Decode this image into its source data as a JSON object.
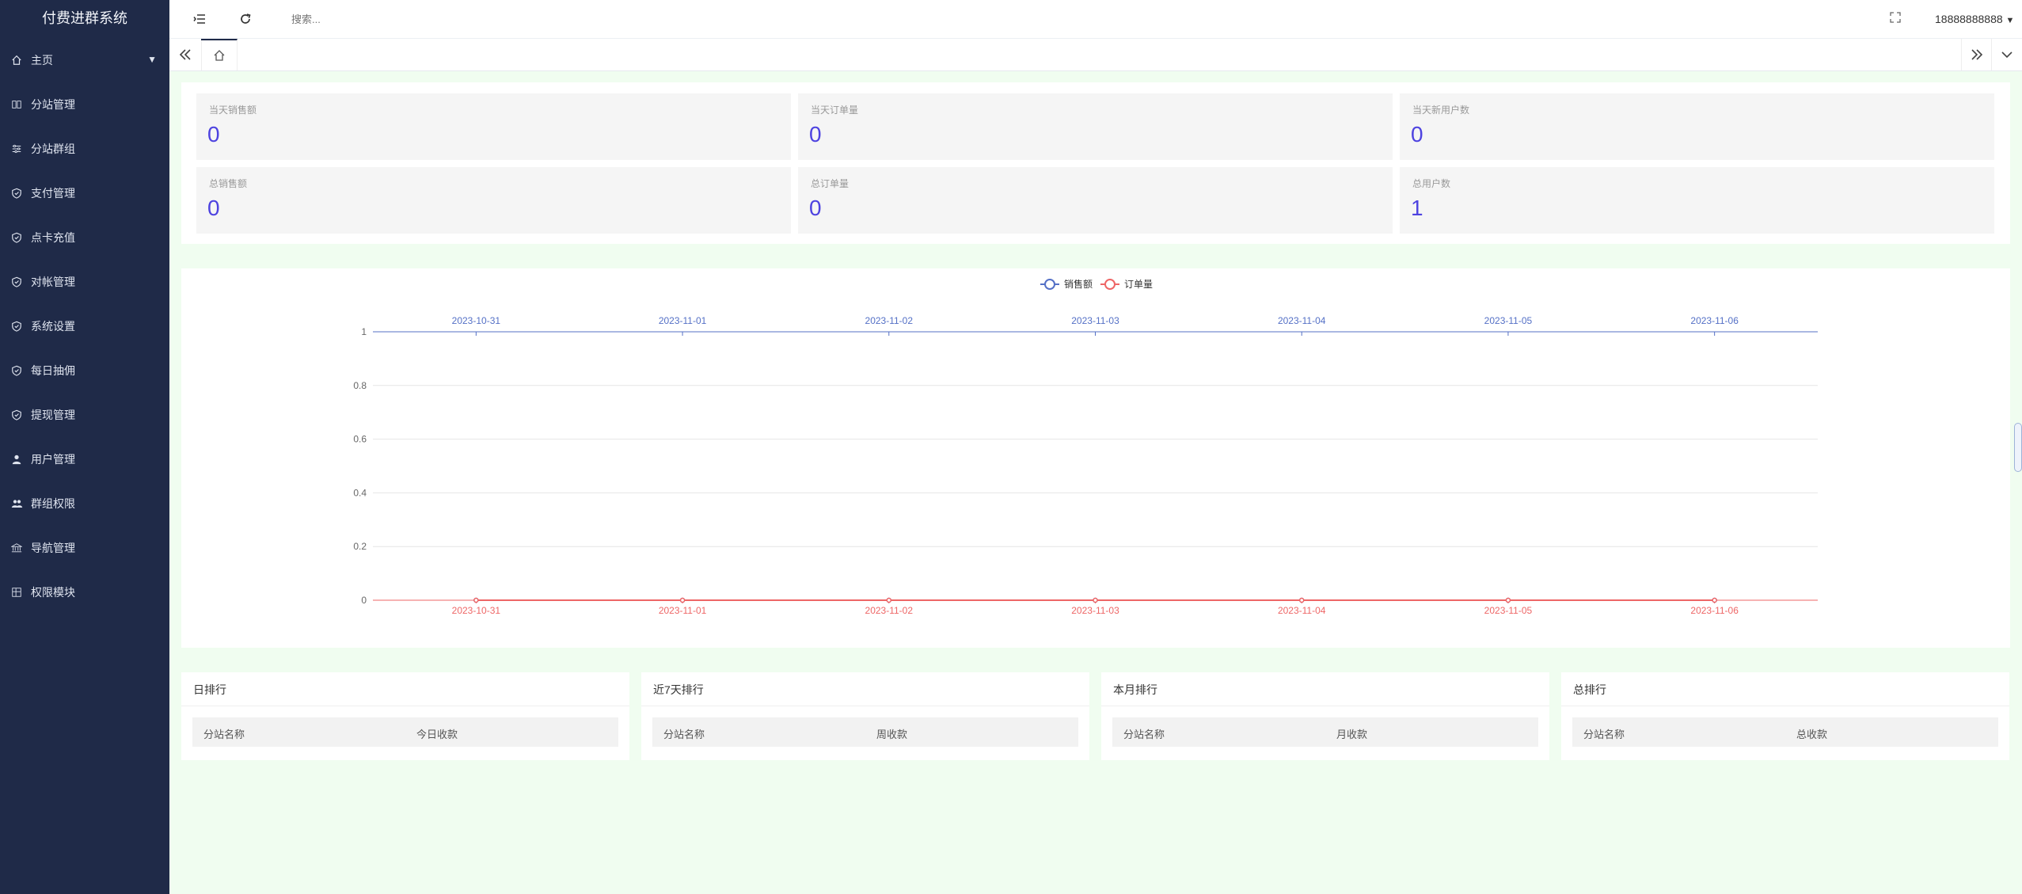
{
  "app": {
    "title": "付费进群系统"
  },
  "sidebar": {
    "items": [
      {
        "label": "主页",
        "icon": "home-icon"
      },
      {
        "label": "分站管理",
        "icon": "columns-icon"
      },
      {
        "label": "分站群组",
        "icon": "sliders-icon"
      },
      {
        "label": "支付管理",
        "icon": "shield-check-icon"
      },
      {
        "label": "点卡充值",
        "icon": "shield-check-icon"
      },
      {
        "label": "对帐管理",
        "icon": "shield-check-icon"
      },
      {
        "label": "系统设置",
        "icon": "shield-check-icon"
      },
      {
        "label": "每日抽佣",
        "icon": "shield-check-icon"
      },
      {
        "label": "提现管理",
        "icon": "shield-check-icon"
      },
      {
        "label": "用户管理",
        "icon": "user-icon"
      },
      {
        "label": "群组权限",
        "icon": "users-icon"
      },
      {
        "label": "导航管理",
        "icon": "bank-icon"
      },
      {
        "label": "权限模块",
        "icon": "grid-icon"
      }
    ]
  },
  "topbar": {
    "search_placeholder": "搜索...",
    "user": "18888888888"
  },
  "stats": [
    {
      "label": "当天销售额",
      "value": "0"
    },
    {
      "label": "当天订单量",
      "value": "0"
    },
    {
      "label": "当天新用户数",
      "value": "0"
    },
    {
      "label": "总销售额",
      "value": "0"
    },
    {
      "label": "总订单量",
      "value": "0"
    },
    {
      "label": "总用户数",
      "value": "1"
    }
  ],
  "chart_data": {
    "type": "line",
    "categories": [
      "2023-10-31",
      "2023-11-01",
      "2023-11-02",
      "2023-11-03",
      "2023-11-04",
      "2023-11-05",
      "2023-11-06"
    ],
    "series": [
      {
        "name": "销售额",
        "values": [
          0,
          0,
          0,
          0,
          0,
          0,
          0
        ],
        "color": "#5470c6"
      },
      {
        "name": "订单量",
        "values": [
          0,
          0,
          0,
          0,
          0,
          0,
          0
        ],
        "color": "#ee6666"
      }
    ],
    "y_ticks": [
      "0",
      "0.2",
      "0.4",
      "0.6",
      "0.8",
      "1"
    ],
    "ylim": [
      0,
      1
    ],
    "grid": true,
    "legend_position": "top-center"
  },
  "rankings": [
    {
      "title": "日排行",
      "col1": "分站名称",
      "col2": "今日收款"
    },
    {
      "title": "近7天排行",
      "col1": "分站名称",
      "col2": "周收款"
    },
    {
      "title": "本月排行",
      "col1": "分站名称",
      "col2": "月收款"
    },
    {
      "title": "总排行",
      "col1": "分站名称",
      "col2": "总收款"
    }
  ]
}
